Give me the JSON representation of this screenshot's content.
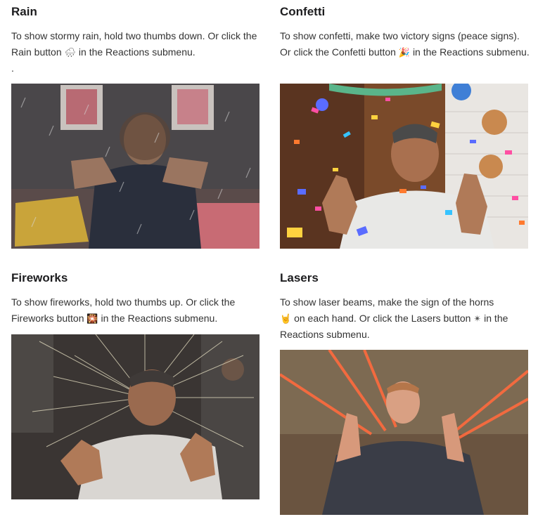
{
  "sections": [
    {
      "title": "Rain",
      "text_before": "To show stormy rain, hold two thumbs down. Or click the Rain button",
      "icon": "rain-cloud-icon",
      "icon_glyph": "🌧",
      "text_after": "in the Reactions submenu.",
      "trailing": ".",
      "photo_icon": "rain-photo"
    },
    {
      "title": "Confetti",
      "text_before": "To show confetti, make two victory signs (peace signs). Or click the Confetti button",
      "icon": "party-popper-icon",
      "icon_glyph": "🎉",
      "text_after": "in the Reactions submenu.",
      "photo_icon": "confetti-photo"
    },
    {
      "title": "Fireworks",
      "text_before": "To show fireworks, hold two thumbs up. Or click the Fireworks button",
      "icon": "sparkler-icon",
      "icon_glyph": "🎇",
      "text_after": "in the Reactions submenu.",
      "photo_icon": "fireworks-photo"
    },
    {
      "title": "Lasers",
      "text_before": "To show laser beams, make the sign of the horns",
      "icon": "horns-hand-icon",
      "icon_glyph": "🤘",
      "text_middle": "on each hand. Or click the Lasers button",
      "icon2": "laser-burst-icon",
      "icon2_glyph": "✴",
      "text_after": "in the Reactions submenu.",
      "photo_icon": "lasers-photo"
    }
  ],
  "colors": {
    "laser": "#ff6a3d",
    "confetti": [
      "#ff4fa3",
      "#5a6cff",
      "#ffd23f",
      "#ff7a2f",
      "#36c3ff"
    ]
  }
}
